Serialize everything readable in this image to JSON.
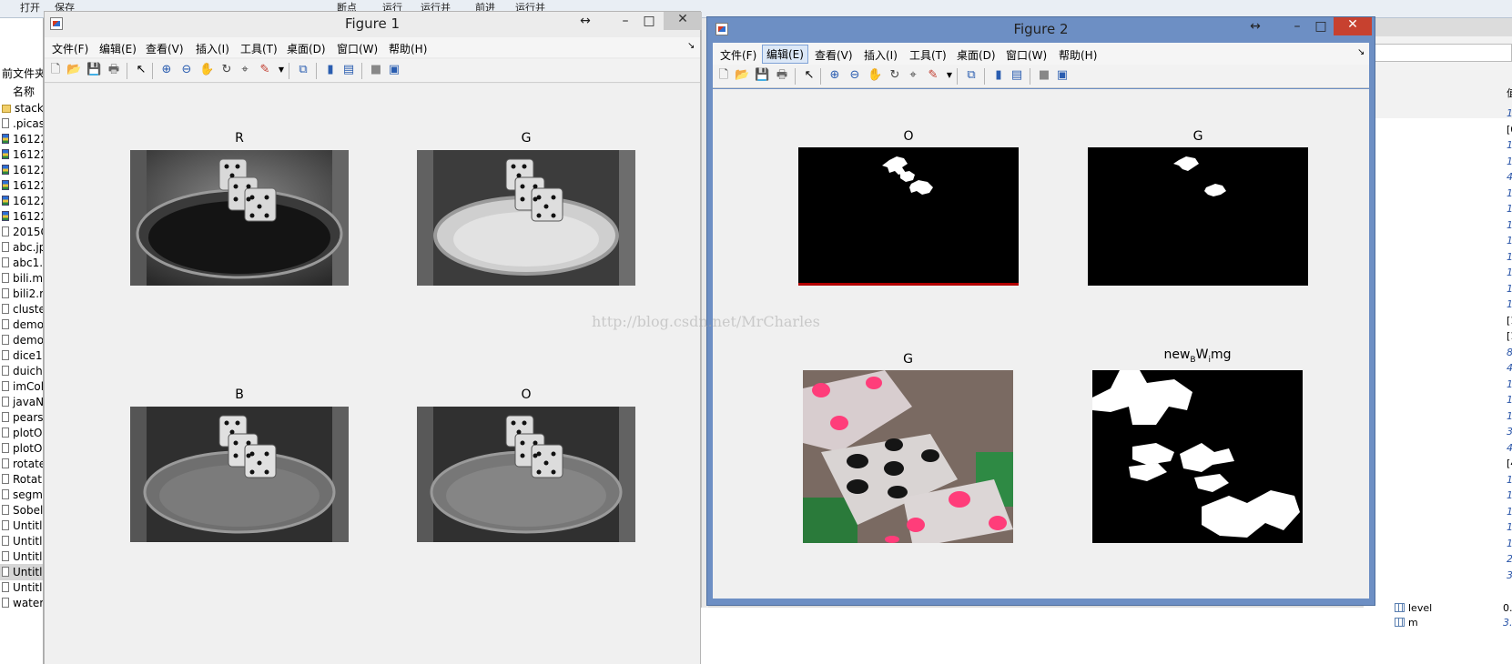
{
  "background": {
    "toolbar_labels": [
      "打开",
      "保存",
      "断点",
      "运行",
      "运行并",
      "前进",
      "运行并"
    ],
    "current_folder_label": "前文件夹",
    "column_name": "名称",
    "files": [
      "stack",
      ".picas",
      "16122",
      "16122",
      "16122",
      "16122",
      "16122",
      "16122",
      "2015C",
      "abc.jp",
      "abc1.",
      "bili.m",
      "bili2.r",
      "cluste",
      "demo",
      "demo",
      "dice1",
      "duich",
      "imCol",
      "javaN",
      "pears",
      "plotO",
      "plotO",
      "rotate",
      "Rotat",
      "segm",
      "Sobel",
      "Untitl",
      "Untitl",
      "Untitl",
      "Untitl",
      "Untitl",
      "water"
    ],
    "workspace_header": "值",
    "workspace_values": [
      "1.",
      "[0",
      "1.",
      "1.",
      "4.",
      "1.",
      "1.",
      "1.",
      "1.",
      "1.",
      "1.",
      "1.",
      "1.",
      "[1",
      "[1",
      "89",
      "4.",
      "1.",
      "1.",
      "1.",
      "3.",
      "4.",
      "[4",
      "1.",
      "1.",
      "1.",
      "1.",
      "1.",
      "2.",
      "3."
    ],
    "workspace_vars": [
      "level",
      "m"
    ],
    "workspace_var_values": [
      "0.",
      "3."
    ]
  },
  "watermark": "http://blog.csdn.net/MrCharles",
  "figure1": {
    "title": "Figure 1",
    "menu": [
      "文件(F)",
      "编辑(E)",
      "查看(V)",
      "插入(I)",
      "工具(T)",
      "桌面(D)",
      "窗口(W)",
      "帮助(H)"
    ],
    "axes": [
      {
        "title": "R"
      },
      {
        "title": "G"
      },
      {
        "title": "B"
      },
      {
        "title": "O"
      }
    ]
  },
  "figure2": {
    "title": "Figure 2",
    "menu": [
      "文件(F)",
      "编辑(E)",
      "查看(V)",
      "插入(I)",
      "工具(T)",
      "桌面(D)",
      "窗口(W)",
      "帮助(H)"
    ],
    "active_menu": "编辑(E)",
    "axes": [
      {
        "title": "O"
      },
      {
        "title": "G"
      },
      {
        "title": "G"
      },
      {
        "title_parts": [
          "new",
          "B",
          "W",
          "i",
          "mg"
        ]
      }
    ]
  },
  "colors": {
    "window_frame_active": "#6d8fc4",
    "window_frame_inactive": "#e9e9e9",
    "close_button": "#c7412f",
    "canvas": "#f0f0f0",
    "dice_pip": "#ff3d7a"
  }
}
